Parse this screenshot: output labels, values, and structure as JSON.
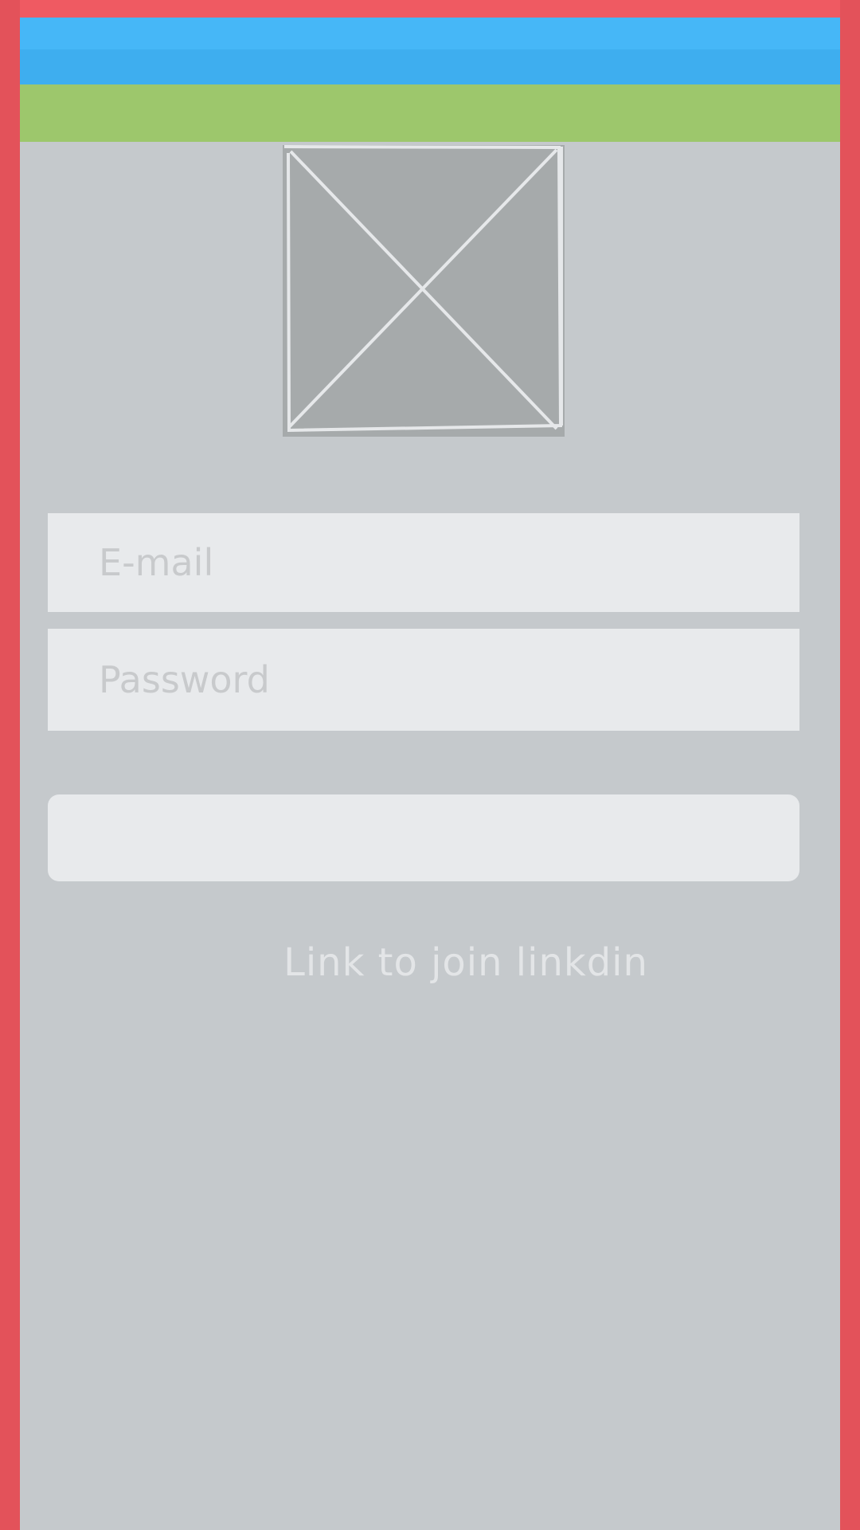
{
  "colors": {
    "background": "#c5c9cc",
    "guide_red": "#e3525a",
    "status_bar": "#46b7f7",
    "app_bar": "#3eaeef",
    "toolbar": "#9dc76c",
    "field_background": "#e8eaec",
    "placeholder_text": "#c8cacc",
    "link_text": "#e3e5e7",
    "image_placeholder": "#a6aaab"
  },
  "logo": {
    "icon": "image-placeholder-icon"
  },
  "form": {
    "email_placeholder": "E-mail",
    "password_placeholder": "Password",
    "submit_label": ""
  },
  "links": {
    "join_label": "Link to join linkdin"
  }
}
